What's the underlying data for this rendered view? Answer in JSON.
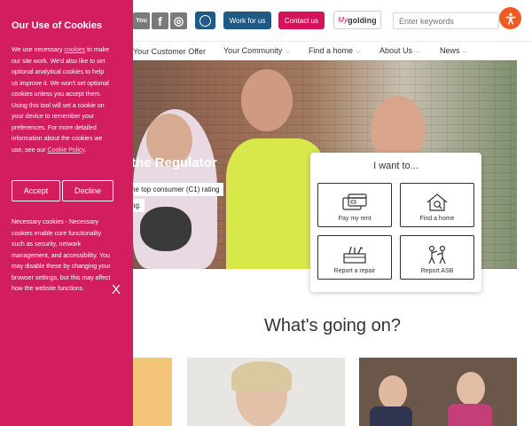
{
  "header": {
    "social": [
      {
        "icon": "youtube-icon",
        "glyph": "You"
      },
      {
        "icon": "facebook-icon",
        "glyph": "f"
      },
      {
        "icon": "instagram-icon",
        "glyph": "◎"
      }
    ],
    "work_label": "Work for us",
    "contact_label": "Contact us",
    "mygolding_my": "My",
    "mygolding_rest": "golding",
    "search_placeholder": "Enter keywords"
  },
  "nav": {
    "items": [
      "Your Customer Offer",
      "Your Community",
      "Find a home",
      "About Us",
      "News"
    ]
  },
  "hero": {
    "title": "the Regulator",
    "line1": "he top consumer (C1) rating",
    "line2": "ng."
  },
  "iwant": {
    "title": "I want to...",
    "tiles": [
      {
        "label": "Pay my rent",
        "icon": "cards-icon"
      },
      {
        "label": "Find a home",
        "icon": "house-search-icon"
      },
      {
        "label": "Report a repair",
        "icon": "toolbox-icon"
      },
      {
        "label": "Report ASB",
        "icon": "people-conflict-icon"
      }
    ]
  },
  "section": {
    "heading": "What's going on?"
  },
  "cookie": {
    "title": "Our Use of Cookies",
    "text_a": "We use necessary ",
    "text_link": "cookies",
    "text_b": " to make our site work. We'd also like to set optional analytical cookies to help us improve it. We won't set optional cookies unless you accept them. Using this tool will set a cookie on your device to remember your preferences. For more detailed information about the cookies we use, see our ",
    "policy_link": "Cookie Policy",
    "text_c": ".",
    "accept": "Accept",
    "decline": "Decline",
    "necessary": "Necessary cookies - Necessary cookies enable core functionality such as security, network management, and accessibility. You may disable these by changing your browser settings, but this may affect how the website functions.",
    "close": "X"
  },
  "colors": {
    "brand_pink": "#d21d5f",
    "brand_blue": "#1f5a86",
    "accessibility_orange": "#ef5a24"
  }
}
